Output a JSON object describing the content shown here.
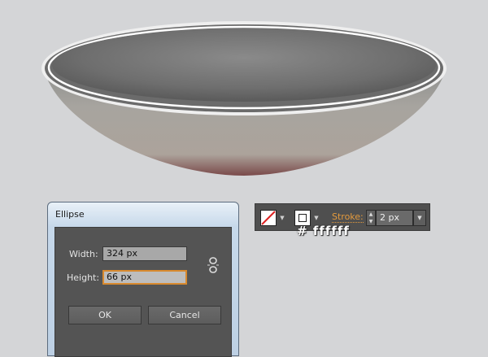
{
  "dialog": {
    "title": "Ellipse",
    "width_label": "Width:",
    "width_value": "324 px",
    "height_label": "Height:",
    "height_value": "66 px",
    "ok_label": "OK",
    "cancel_label": "Cancel"
  },
  "control_panel": {
    "fill_swatch": "none",
    "stroke_swatch_color": "#ffffff",
    "stroke_label": "Stroke:",
    "stroke_weight": "2 px"
  },
  "annotation": {
    "color_text": "# ffffff"
  },
  "colors": {
    "canvas": "#d4d5d7",
    "bowl_inner": "#7d7d7d",
    "bowl_outer": "#aaa49d",
    "rim": "#ffffff",
    "accent": "#e39a3d"
  }
}
